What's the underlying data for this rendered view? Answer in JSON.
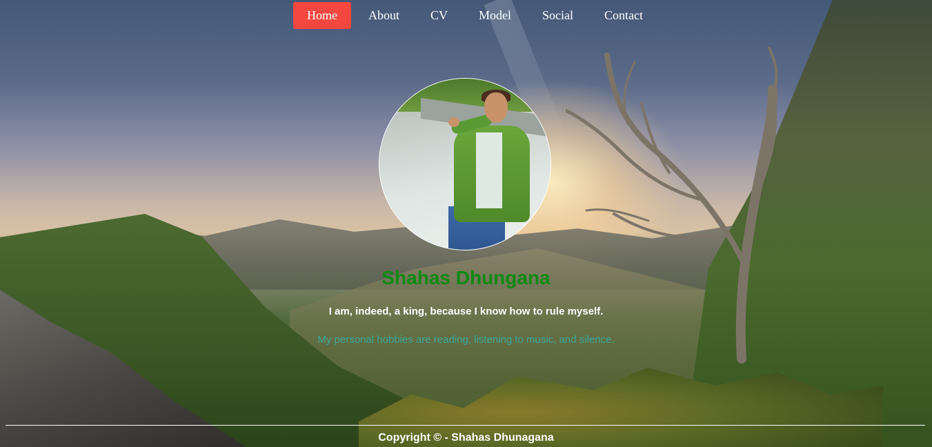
{
  "nav": {
    "items": [
      {
        "label": "Home",
        "active": true
      },
      {
        "label": "About",
        "active": false
      },
      {
        "label": "CV",
        "active": false
      },
      {
        "label": "Model",
        "active": false
      },
      {
        "label": "Social",
        "active": false
      },
      {
        "label": "Contact",
        "active": false
      }
    ]
  },
  "profile": {
    "name": "Shahas Dhungana",
    "quote": "I am, indeed, a king, because I know how to rule myself.",
    "hobbies": "My personal hobbies are reading, listening to music, and silence."
  },
  "footer": {
    "copyright": "Copyright © - Shahas Dhunagana"
  },
  "colors": {
    "nav_active": "#f4473f",
    "name": "#0b8a12",
    "hobbies": "#3aa89a",
    "text_light": "#ffffff"
  }
}
